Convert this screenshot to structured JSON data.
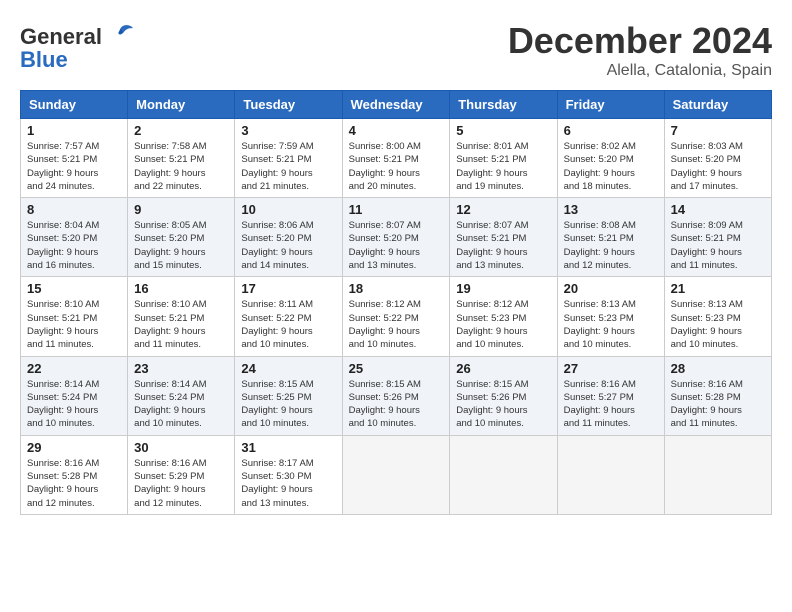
{
  "logo": {
    "general": "General",
    "blue": "Blue"
  },
  "title": "December 2024",
  "location": "Alella, Catalonia, Spain",
  "weekdays": [
    "Sunday",
    "Monday",
    "Tuesday",
    "Wednesday",
    "Thursday",
    "Friday",
    "Saturday"
  ],
  "weeks": [
    [
      {
        "day": "1",
        "info": "Sunrise: 7:57 AM\nSunset: 5:21 PM\nDaylight: 9 hours\nand 24 minutes."
      },
      {
        "day": "2",
        "info": "Sunrise: 7:58 AM\nSunset: 5:21 PM\nDaylight: 9 hours\nand 22 minutes."
      },
      {
        "day": "3",
        "info": "Sunrise: 7:59 AM\nSunset: 5:21 PM\nDaylight: 9 hours\nand 21 minutes."
      },
      {
        "day": "4",
        "info": "Sunrise: 8:00 AM\nSunset: 5:21 PM\nDaylight: 9 hours\nand 20 minutes."
      },
      {
        "day": "5",
        "info": "Sunrise: 8:01 AM\nSunset: 5:21 PM\nDaylight: 9 hours\nand 19 minutes."
      },
      {
        "day": "6",
        "info": "Sunrise: 8:02 AM\nSunset: 5:20 PM\nDaylight: 9 hours\nand 18 minutes."
      },
      {
        "day": "7",
        "info": "Sunrise: 8:03 AM\nSunset: 5:20 PM\nDaylight: 9 hours\nand 17 minutes."
      }
    ],
    [
      {
        "day": "8",
        "info": "Sunrise: 8:04 AM\nSunset: 5:20 PM\nDaylight: 9 hours\nand 16 minutes."
      },
      {
        "day": "9",
        "info": "Sunrise: 8:05 AM\nSunset: 5:20 PM\nDaylight: 9 hours\nand 15 minutes."
      },
      {
        "day": "10",
        "info": "Sunrise: 8:06 AM\nSunset: 5:20 PM\nDaylight: 9 hours\nand 14 minutes."
      },
      {
        "day": "11",
        "info": "Sunrise: 8:07 AM\nSunset: 5:20 PM\nDaylight: 9 hours\nand 13 minutes."
      },
      {
        "day": "12",
        "info": "Sunrise: 8:07 AM\nSunset: 5:21 PM\nDaylight: 9 hours\nand 13 minutes."
      },
      {
        "day": "13",
        "info": "Sunrise: 8:08 AM\nSunset: 5:21 PM\nDaylight: 9 hours\nand 12 minutes."
      },
      {
        "day": "14",
        "info": "Sunrise: 8:09 AM\nSunset: 5:21 PM\nDaylight: 9 hours\nand 11 minutes."
      }
    ],
    [
      {
        "day": "15",
        "info": "Sunrise: 8:10 AM\nSunset: 5:21 PM\nDaylight: 9 hours\nand 11 minutes."
      },
      {
        "day": "16",
        "info": "Sunrise: 8:10 AM\nSunset: 5:21 PM\nDaylight: 9 hours\nand 11 minutes."
      },
      {
        "day": "17",
        "info": "Sunrise: 8:11 AM\nSunset: 5:22 PM\nDaylight: 9 hours\nand 10 minutes."
      },
      {
        "day": "18",
        "info": "Sunrise: 8:12 AM\nSunset: 5:22 PM\nDaylight: 9 hours\nand 10 minutes."
      },
      {
        "day": "19",
        "info": "Sunrise: 8:12 AM\nSunset: 5:23 PM\nDaylight: 9 hours\nand 10 minutes."
      },
      {
        "day": "20",
        "info": "Sunrise: 8:13 AM\nSunset: 5:23 PM\nDaylight: 9 hours\nand 10 minutes."
      },
      {
        "day": "21",
        "info": "Sunrise: 8:13 AM\nSunset: 5:23 PM\nDaylight: 9 hours\nand 10 minutes."
      }
    ],
    [
      {
        "day": "22",
        "info": "Sunrise: 8:14 AM\nSunset: 5:24 PM\nDaylight: 9 hours\nand 10 minutes."
      },
      {
        "day": "23",
        "info": "Sunrise: 8:14 AM\nSunset: 5:24 PM\nDaylight: 9 hours\nand 10 minutes."
      },
      {
        "day": "24",
        "info": "Sunrise: 8:15 AM\nSunset: 5:25 PM\nDaylight: 9 hours\nand 10 minutes."
      },
      {
        "day": "25",
        "info": "Sunrise: 8:15 AM\nSunset: 5:26 PM\nDaylight: 9 hours\nand 10 minutes."
      },
      {
        "day": "26",
        "info": "Sunrise: 8:15 AM\nSunset: 5:26 PM\nDaylight: 9 hours\nand 10 minutes."
      },
      {
        "day": "27",
        "info": "Sunrise: 8:16 AM\nSunset: 5:27 PM\nDaylight: 9 hours\nand 11 minutes."
      },
      {
        "day": "28",
        "info": "Sunrise: 8:16 AM\nSunset: 5:28 PM\nDaylight: 9 hours\nand 11 minutes."
      }
    ],
    [
      {
        "day": "29",
        "info": "Sunrise: 8:16 AM\nSunset: 5:28 PM\nDaylight: 9 hours\nand 12 minutes."
      },
      {
        "day": "30",
        "info": "Sunrise: 8:16 AM\nSunset: 5:29 PM\nDaylight: 9 hours\nand 12 minutes."
      },
      {
        "day": "31",
        "info": "Sunrise: 8:17 AM\nSunset: 5:30 PM\nDaylight: 9 hours\nand 13 minutes."
      },
      null,
      null,
      null,
      null
    ]
  ]
}
